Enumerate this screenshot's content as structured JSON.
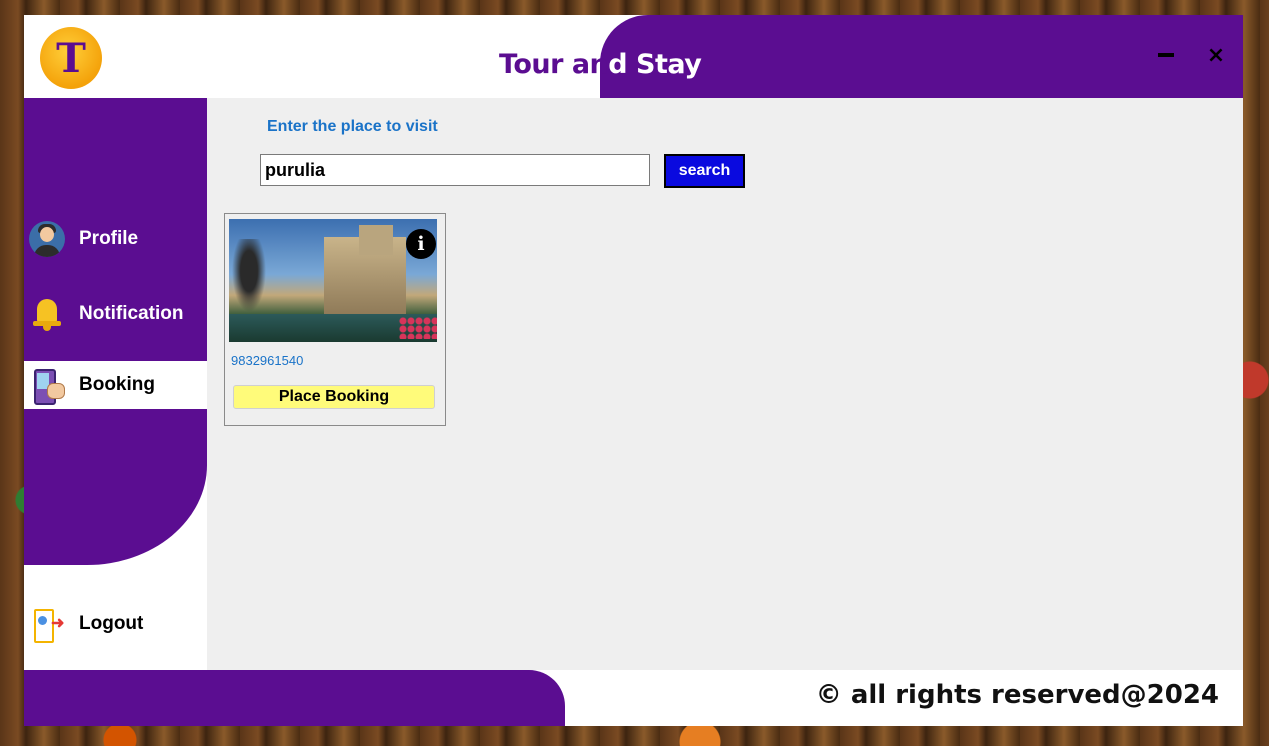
{
  "header": {
    "logo_letter": "T",
    "title_part1": "Tour an",
    "title_part2": "d Stay",
    "minimize_label": "",
    "close_label": "×"
  },
  "sidebar": {
    "items": [
      {
        "label": "Profile",
        "icon": "avatar-icon"
      },
      {
        "label": "Notification",
        "icon": "bell-icon"
      },
      {
        "label": "Booking",
        "icon": "booking-icon",
        "active": true
      },
      {
        "label": "Logout",
        "icon": "logout-icon"
      }
    ]
  },
  "search": {
    "heading": "Enter the place to visit",
    "value": "purulia",
    "button_label": "search"
  },
  "results": [
    {
      "image": "hotel-photo",
      "phone": "9832961540",
      "info_icon": "i",
      "button_label": "Place Booking"
    }
  ],
  "footer": {
    "copyright": "© all rights reserved@2024"
  },
  "colors": {
    "brand_purple": "#5b0d91",
    "search_button": "#0a0adf",
    "booking_button": "#fffb7a",
    "link_blue": "#1a73c8"
  }
}
